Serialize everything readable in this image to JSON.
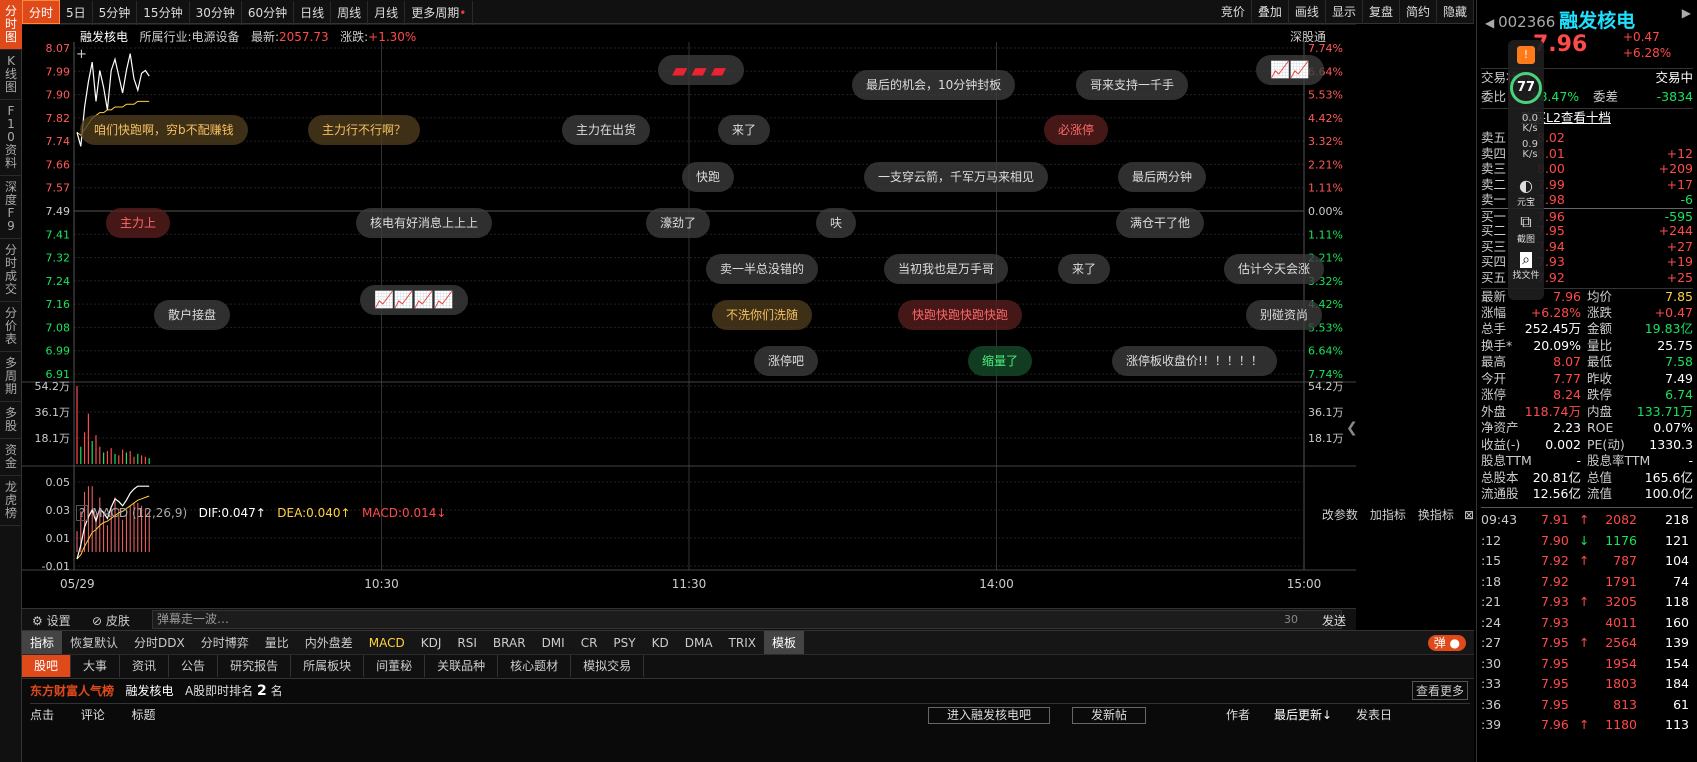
{
  "sidebar": [
    "分时图",
    "K线图",
    "F10资料",
    "深度F9",
    "分时成交",
    "分价表",
    "多周期",
    "多股",
    "资金",
    "龙虎榜"
  ],
  "topbar": {
    "left": [
      "分时",
      "5日",
      "5分钟",
      "15分钟",
      "30分钟",
      "60分钟",
      "日线",
      "周线",
      "月线",
      "更多周期"
    ],
    "right": [
      "竞价",
      "叠加",
      "画线",
      "显示",
      "复盘",
      "简约",
      "隐藏"
    ]
  },
  "stock": {
    "name": "融发核电",
    "industry_label": "所属行业:",
    "industry": "电源设备",
    "latest_label": "最新:",
    "latest": "2057.73",
    "change_label": "涨跌:",
    "change": "+1.30%",
    "market": "深股通",
    "tag": "东方财富人气榜"
  },
  "chart_data": {
    "type": "line",
    "y_left_ticks": [
      "8.07",
      "7.99",
      "7.90",
      "7.82",
      "7.74",
      "7.66",
      "7.57",
      "7.49",
      "7.41",
      "7.32",
      "7.24",
      "7.16",
      "7.08",
      "6.99",
      "6.91"
    ],
    "y_right_ticks": [
      "7.74%",
      "6.64%",
      "5.53%",
      "4.42%",
      "3.32%",
      "2.21%",
      "1.11%",
      "0.00%",
      "1.11%",
      "2.21%",
      "3.32%",
      "4.42%",
      "5.53%",
      "6.64%",
      "7.74%"
    ],
    "ylim": [
      6.91,
      8.07
    ],
    "prev_close": 7.49,
    "x_ticks": [
      "05/29",
      "10:30",
      "11:30",
      "14:00",
      "15:00"
    ],
    "price": [
      7.77,
      7.72,
      7.86,
      7.95,
      8.02,
      7.88,
      7.99,
      7.93,
      7.85,
      7.99,
      8.03,
      7.97,
      7.91,
      7.99,
      8.05,
      7.96,
      7.92,
      7.98,
      7.99,
      7.97
    ],
    "avg": [
      7.77,
      7.76,
      7.78,
      7.8,
      7.82,
      7.83,
      7.84,
      7.84,
      7.85,
      7.85,
      7.86,
      7.86,
      7.86,
      7.87,
      7.87,
      7.87,
      7.88,
      7.88,
      7.88,
      7.88
    ],
    "vol_ticks": [
      "54.2万",
      "36.1万",
      "18.1万"
    ],
    "volume": [
      54.2,
      12,
      22,
      35,
      16,
      20,
      12,
      8,
      9,
      11,
      7,
      6,
      10,
      8,
      9,
      5,
      7,
      6,
      5,
      4
    ],
    "macd_ticks": [
      "0.05",
      "0.03",
      "0.01",
      "-0.01"
    ],
    "dif": [
      -0.005,
      0.005,
      0.018,
      0.025,
      0.03,
      0.022,
      0.031,
      0.028,
      0.024,
      0.032,
      0.038,
      0.036,
      0.033,
      0.037,
      0.042,
      0.045,
      0.047,
      0.047,
      0.047,
      0.047
    ],
    "dea": [
      -0.005,
      -0.002,
      0.004,
      0.009,
      0.014,
      0.016,
      0.019,
      0.021,
      0.022,
      0.024,
      0.026,
      0.028,
      0.029,
      0.031,
      0.033,
      0.035,
      0.037,
      0.038,
      0.039,
      0.04
    ]
  },
  "macd": {
    "label": "MACD (12,26,9)",
    "dif": "DIF:0.047↑",
    "dea": "DEA:0.040↑",
    "macd": "MACD:0.014↓",
    "actions": [
      "改参数",
      "加指标",
      "换指标"
    ]
  },
  "danmu": [
    {
      "t": "咱们快跑啊，穷b不配赚钱",
      "x": 80,
      "y": 115,
      "c": "gold"
    },
    {
      "t": "主力行不行啊？",
      "x": 308,
      "y": 115,
      "c": "gold"
    },
    {
      "t": "主力在出货",
      "x": 562,
      "y": 115,
      "c": ""
    },
    {
      "t": "来了",
      "x": 718,
      "y": 115,
      "c": ""
    },
    {
      "t": "必涨停",
      "x": 1044,
      "y": 115,
      "c": "red"
    },
    {
      "t": "最后的机会，10分钟封板",
      "x": 852,
      "y": 70,
      "c": ""
    },
    {
      "t": "哥来支持一千手",
      "x": 1076,
      "y": 70,
      "c": ""
    },
    {
      "t": "快跑",
      "x": 682,
      "y": 162,
      "c": ""
    },
    {
      "t": "一支穿云箭，千军万马来相见",
      "x": 864,
      "y": 162,
      "c": ""
    },
    {
      "t": "最后两分钟",
      "x": 1118,
      "y": 162,
      "c": ""
    },
    {
      "t": "主力上",
      "x": 106,
      "y": 208,
      "c": "red"
    },
    {
      "t": "核电有好消息上上上",
      "x": 356,
      "y": 208,
      "c": ""
    },
    {
      "t": "濠劲了",
      "x": 646,
      "y": 208,
      "c": ""
    },
    {
      "t": "呋",
      "x": 816,
      "y": 208,
      "c": ""
    },
    {
      "t": "满仓干了他",
      "x": 1116,
      "y": 208,
      "c": ""
    },
    {
      "t": "卖一半总没错的",
      "x": 706,
      "y": 254,
      "c": ""
    },
    {
      "t": "当初我也是万手哥",
      "x": 884,
      "y": 254,
      "c": ""
    },
    {
      "t": "来了",
      "x": 1058,
      "y": 254,
      "c": ""
    },
    {
      "t": "估计今天会涨",
      "x": 1224,
      "y": 254,
      "c": ""
    },
    {
      "t": "散户接盘",
      "x": 154,
      "y": 300,
      "c": ""
    },
    {
      "t": "不洗你们洗随",
      "x": 712,
      "y": 300,
      "c": "gold"
    },
    {
      "t": "快跑快跑快跑快跑",
      "x": 898,
      "y": 300,
      "c": "red"
    },
    {
      "t": "别碰资尚",
      "x": 1246,
      "y": 300,
      "c": ""
    },
    {
      "t": "涨停吧",
      "x": 754,
      "y": 346,
      "c": ""
    },
    {
      "t": "缩量了",
      "x": 968,
      "y": 346,
      "c": "green"
    },
    {
      "t": "涨停板收盘价!！！！！！",
      "x": 1112,
      "y": 346,
      "c": ""
    }
  ],
  "controls": {
    "settings": "设置",
    "skin": "皮肤",
    "input_placeholder": "弹幕走一波…",
    "count": "30",
    "send": "发送",
    "popup": "弹"
  },
  "indicators": [
    "指标",
    "恢复默认",
    "分时DDX",
    "分时博弈",
    "量比",
    "内外盘差",
    "MACD",
    "KDJ",
    "RSI",
    "BRAR",
    "DMI",
    "CR",
    "PSY",
    "KD",
    "DMA",
    "TRIX",
    "模板"
  ],
  "guba": {
    "tabs": [
      "股吧",
      "大事",
      "资讯",
      "公告",
      "研究报告",
      "所属板块",
      "间董秘",
      "关联品种",
      "核心题材",
      "模拟交易"
    ],
    "rank_label": "A股即时排名",
    "rank": "2",
    "rank_unit": "名",
    "view_more": "查看更多",
    "cols": [
      "点击",
      "评论",
      "标题"
    ],
    "enter": "进入融发核电吧",
    "post": "发新帖",
    "author": "作者",
    "latest": "最后更新",
    "posted": "发表日"
  },
  "quote": {
    "code": "002366",
    "name": "融发核电",
    "price": "7.96",
    "chg": "+0.47",
    "chg_pct": "+6.28%",
    "status_label": "交易状态",
    "status": "交易中",
    "wb_label": "委比",
    "wb": "-88.47%",
    "wc_label": "委差",
    "wc": "-3834",
    "l2": "购买L2查看十档",
    "sell": [
      [
        "卖五",
        "8.02",
        ""
      ],
      [
        "卖四",
        "8.01",
        "+12"
      ],
      [
        "卖三",
        "8.00",
        "+209"
      ],
      [
        "卖二",
        "7.99",
        "+17"
      ],
      [
        "卖一",
        "7.98",
        "-6"
      ]
    ],
    "buy": [
      [
        "买一",
        "7.96",
        "-595"
      ],
      [
        "买二",
        "7.95",
        "+244"
      ],
      [
        "买三",
        "7.94",
        "+27"
      ],
      [
        "买四",
        "7.93",
        "+19"
      ],
      [
        "买五",
        "7.92",
        "+25"
      ]
    ],
    "stats": [
      [
        "最新",
        "7.96",
        "均价",
        "7.85"
      ],
      [
        "涨幅",
        "+6.28%",
        "涨跌",
        "+0.47"
      ],
      [
        "总手",
        "252.45万",
        "金额",
        "19.83亿"
      ],
      [
        "换手*",
        "20.09%",
        "量比",
        "25.75"
      ],
      [
        "最高",
        "8.07",
        "最低",
        "7.58"
      ],
      [
        "今开",
        "7.77",
        "昨收",
        "7.49"
      ],
      [
        "涨停",
        "8.24",
        "跌停",
        "6.74"
      ],
      [
        "外盘",
        "118.74万",
        "内盘",
        "133.71万"
      ],
      [
        "净资产",
        "2.23",
        "ROE",
        "0.07%"
      ],
      [
        "收益(-)",
        "0.002",
        "PE(动)",
        "1330.3"
      ],
      [
        "股息TTM",
        "-",
        "股息率TTM",
        "-"
      ],
      [
        "总股本",
        "20.81亿",
        "总值",
        "165.6亿"
      ],
      [
        "流通股",
        "12.56亿",
        "流值",
        "100.0亿"
      ]
    ],
    "ticks": [
      [
        "09:43",
        "7.91",
        "↑",
        "2082",
        "218"
      ],
      [
        ":12",
        "7.90",
        "↓",
        "1176",
        "121"
      ],
      [
        ":15",
        "7.92",
        "↑",
        "787",
        "104"
      ],
      [
        ":18",
        "7.92",
        "",
        "1791",
        "74"
      ],
      [
        ":21",
        "7.93",
        "↑",
        "3205",
        "118"
      ],
      [
        ":24",
        "7.93",
        "",
        "4011",
        "160"
      ],
      [
        ":27",
        "7.95",
        "↑",
        "2564",
        "139"
      ],
      [
        ":30",
        "7.95",
        "",
        "1954",
        "154"
      ],
      [
        ":33",
        "7.95",
        "",
        "1803",
        "184"
      ],
      [
        ":36",
        "7.95",
        "",
        "813",
        "61"
      ],
      [
        ":39",
        "7.96",
        "↑",
        "1180",
        "113"
      ]
    ]
  },
  "float": {
    "score": "77",
    "score_unit": "%",
    "up": "0.0",
    "up_unit": "K/s",
    "down": "0.9",
    "down_unit": "K/s",
    "tools": [
      "元宝",
      "截图",
      "找文件"
    ]
  },
  "colors": {
    "accent": "#e04a1a",
    "up": "#ff4a4a",
    "down": "#19e35b",
    "avg": "#ffd23d"
  }
}
